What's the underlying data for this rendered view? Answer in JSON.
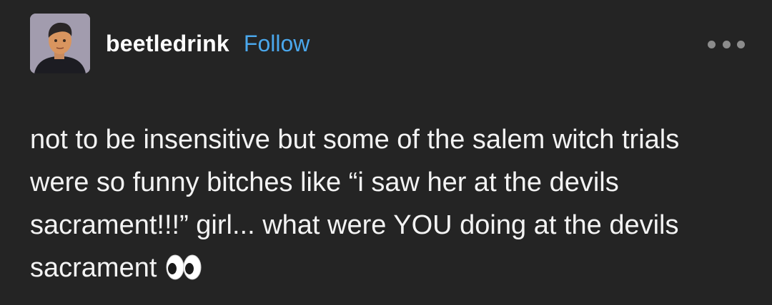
{
  "post": {
    "username": "beetledrink",
    "follow_label": "Follow",
    "more_icon": "more-horizontal-icon",
    "avatar_icon": "user-avatar",
    "text": "not to be insensitive but some of the salem witch trials were so funny bitches like “i saw her at the devils sacrament!!!” girl... what were YOU doing at the devils sacrament",
    "emoji_icon": "eyes-emoji-icon"
  },
  "colors": {
    "background": "#242424",
    "text": "#ffffff",
    "link": "#4aa7ec",
    "muted": "#8c8c8c"
  }
}
